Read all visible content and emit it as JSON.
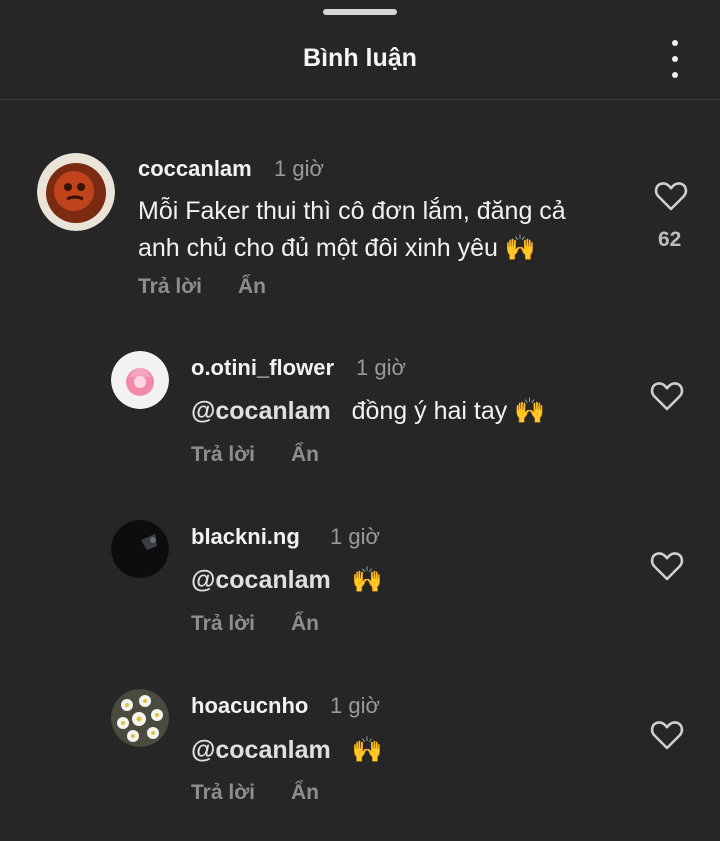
{
  "header": {
    "title": "Bình luận"
  },
  "comments": [
    {
      "username": "coccanlam",
      "time": "1 giờ",
      "text_line1": "Mỗi Faker thui thì cô đơn lắm, đăng cả",
      "text_line2": "anh chủ cho đủ một đôi xinh yêu 🙌",
      "reply_label": "Trả lời",
      "hide_label": "Ẩn",
      "likes": "62"
    },
    {
      "username": "o.otini_flower",
      "time": "1 giờ",
      "mention": "@cocanlam",
      "text": "đồng ý hai tay 🙌",
      "reply_label": "Trả lời",
      "hide_label": "Ẩn"
    },
    {
      "username": "blackni.ng",
      "time": "1 giờ",
      "mention": "@cocanlam",
      "text": "🙌",
      "reply_label": "Trả lời",
      "hide_label": "Ẩn"
    },
    {
      "username": "hoacucnho",
      "time": "1 giờ",
      "mention": "@cocanlam",
      "text": "🙌",
      "reply_label": "Trả lời",
      "hide_label": "Ẩn"
    }
  ]
}
